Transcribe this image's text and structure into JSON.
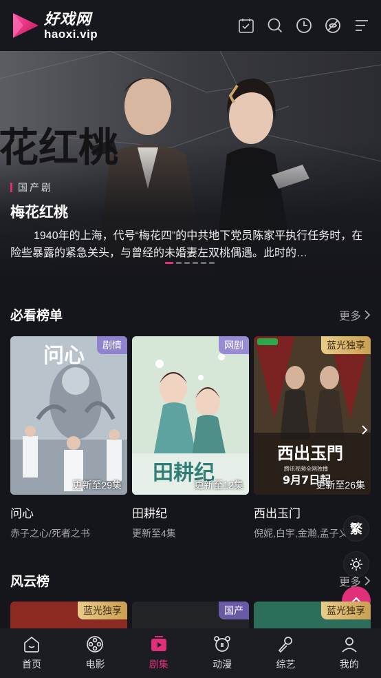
{
  "header": {
    "logo_cn": "好戏网",
    "logo_en": "haoxi.vip",
    "icons": [
      "calendar-check-icon",
      "search-icon",
      "clock-history-icon",
      "no-ads-icon",
      "menu-icon"
    ]
  },
  "banner": {
    "art_text": "花红桃",
    "category": "国产剧",
    "title": "梅花红桃",
    "description": "1940年的上海，代号“梅花四”的中共地下党员陈家平执行任务时，在险些暴露的紧急关头，与曾经的未婚妻左双桃偶遇。此时的…",
    "dots": 6,
    "active_dot": 0
  },
  "section1": {
    "title": "必看榜单",
    "more": "更多",
    "cards": [
      {
        "title": "问心",
        "sub": "赤子之心/死者之书",
        "badge": "剧情",
        "episodes": "更新至29集",
        "poster_text": "问心"
      },
      {
        "title": "田耕纪",
        "sub": "更新至4集",
        "badge": "网剧",
        "episodes": "更新至12集",
        "poster_text": "田耕纪"
      },
      {
        "title": "西出玉门",
        "sub": "倪妮,白宇,金瀚,孟子义",
        "badge": "蓝光独享",
        "episodes": "更新至26集",
        "poster_text": "西出玉門",
        "poster_date": "9月7日起",
        "poster_small": "腾讯视频全网独播"
      }
    ]
  },
  "floating": {
    "traditional": "繁",
    "theme_icon": "sun-icon",
    "top_icon": "chevron-up-icon"
  },
  "section2": {
    "title": "风云榜",
    "more": "更多",
    "badges": [
      "蓝光独享",
      "国产",
      "蓝光独享"
    ]
  },
  "nav": [
    {
      "label": "首页",
      "icon": "home-icon",
      "active": false
    },
    {
      "label": "电影",
      "icon": "film-reel-icon",
      "active": false
    },
    {
      "label": "剧集",
      "icon": "play-tv-icon",
      "active": true
    },
    {
      "label": "动漫",
      "icon": "bear-icon",
      "active": false
    },
    {
      "label": "综艺",
      "icon": "microphone-icon",
      "active": false
    },
    {
      "label": "我的",
      "icon": "user-icon",
      "active": false
    }
  ],
  "colors": {
    "accent": "#e0307a",
    "background": "#15161b"
  }
}
